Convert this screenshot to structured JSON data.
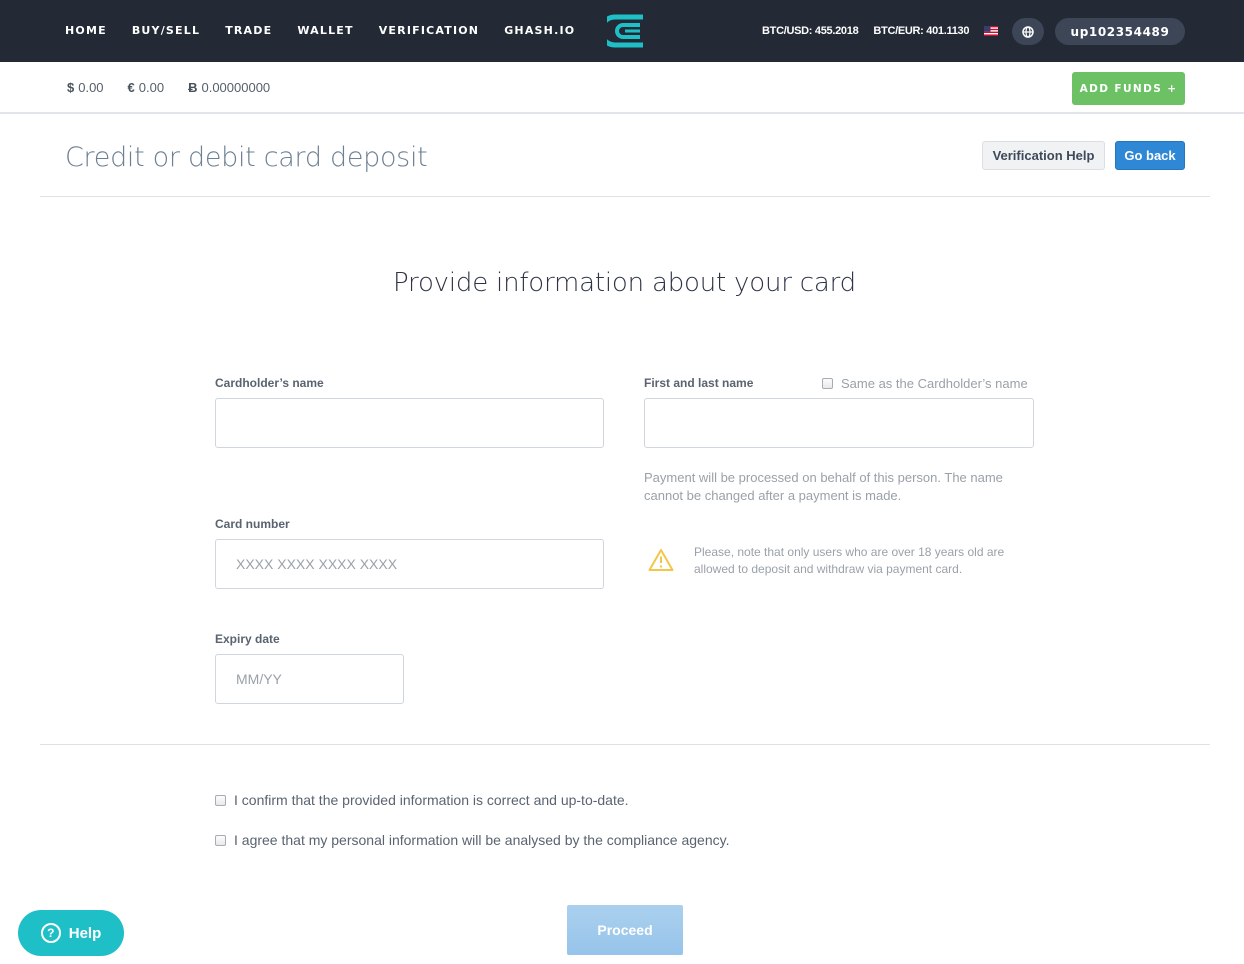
{
  "nav": {
    "links": [
      "HOME",
      "BUY/SELL",
      "TRADE",
      "WALLET",
      "VERIFICATION",
      "GHASH.IO"
    ],
    "rates": {
      "btc_usd": "BTC/USD: 455.2018",
      "btc_eur": "BTC/EUR: 401.1130"
    },
    "language_flag": "us-flag-icon",
    "language_icon": "globe-icon",
    "username": "up102354489",
    "brand_color": "#1fbfc8"
  },
  "balances": {
    "usd": {
      "symbol": "$",
      "amount": "0.00"
    },
    "eur": {
      "symbol": "€",
      "amount": "0.00"
    },
    "btc": {
      "symbol": "Ƀ",
      "amount": "0.00000000"
    },
    "add_funds_label": "ADD FUNDS +"
  },
  "page": {
    "title": "Credit or debit card deposit",
    "verification_help_label": "Verification Help",
    "go_back_label": "Go back"
  },
  "form": {
    "section_title": "Provide information about your card",
    "cardholder_name": {
      "label": "Cardholder’s name",
      "value": "",
      "placeholder": ""
    },
    "first_last_name": {
      "label": "First and last name",
      "value": "",
      "placeholder": ""
    },
    "same_as_cardholder": {
      "label": "Same as the Cardholder’s name",
      "checked": false
    },
    "payment_hint": "Payment will be processed on behalf of this person. The name cannot be changed after a payment is made.",
    "card_number": {
      "label": "Card number",
      "value": "",
      "placeholder": "XXXX XXXX XXXX XXXX"
    },
    "age_warning": "Please, note that only users who are over 18 years old are allowed to deposit and withdraw via payment card.",
    "expiry_date": {
      "label": "Expiry date",
      "value": "",
      "placeholder": "MM/YY"
    },
    "confirm_info": {
      "label": "I confirm that the provided information is correct and up-to-date.",
      "checked": false
    },
    "confirm_compliance": {
      "label": "I agree that my personal information will be analysed by the compliance agency.",
      "checked": false
    },
    "proceed_label": "Proceed"
  },
  "help_widget": {
    "label": "Help",
    "icon": "?"
  }
}
